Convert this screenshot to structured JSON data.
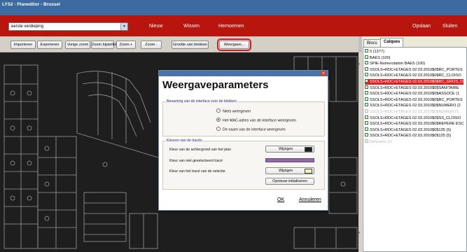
{
  "window": {
    "title": "LYS2 - Planeditor - Brussel"
  },
  "menubar": {
    "floor_selector": "eerste verdieping",
    "items": [
      "Nieuw",
      "Wissen",
      "Hernoemen",
      "Opslaan",
      "Sluiten"
    ]
  },
  "toolbar": {
    "buttons": [
      "Importeren",
      "Exporteren",
      "Vorige zoom",
      "Zoom bijstellen",
      "Zoom +",
      "Zoom -",
      "Grootte van blokken",
      "Weergave..."
    ]
  },
  "panel": {
    "tabs": [
      "Blocs",
      "Calques"
    ],
    "layers": [
      {
        "label": "0  (1377)",
        "state": "normal"
      },
      {
        "label": "BAES  (100)",
        "state": "normal"
      },
      {
        "label": "SPIE-Numerotation BAES  (100)",
        "state": "normal"
      },
      {
        "label": "SSOLS+RDC+ETAGES 02.03.2010$0$RC_PORTES",
        "state": "normal"
      },
      {
        "label": "SSOLS+RDC+ETAGES 02.03.2010$0$RC_CLOISO",
        "state": "normal"
      },
      {
        "label": "SSOLS+RDC+ETAGES 02.03.2010$0$RC_GROS_O",
        "state": "highlight"
      },
      {
        "label": "SSOLS+RDC+ETAGES 02.03.2010$0$SANITAIRE",
        "state": "normal"
      },
      {
        "label": "SSOLS+RDC+ETAGES 02.03.2010$0$ASSOCE  (1",
        "state": "normal"
      },
      {
        "label": "SSOLS+RDC+ETAGES 02.03.2010$0$RC_PORTES",
        "state": "normal"
      },
      {
        "label": "SSOLS+RDC+ETAGES 02.03.2010$0$NUMERO  (2",
        "state": "normal"
      },
      {
        "label": "SSOLS+RDC+ETAGES 02.03.2010$0$NUMEROS",
        "state": "dim"
      },
      {
        "label": "SSOLS+RDC+ETAGES 02.03.2010$0$SS_CLOISO",
        "state": "normal"
      },
      {
        "label": "SSOLS+RDC+ETAGES 02.03.2010$0$REPERE ESC",
        "state": "normal"
      },
      {
        "label": "SSOLS+RDC+ETAGES 02.03.2010$0$135  (5)",
        "state": "normal"
      },
      {
        "label": "SSOLS+RDC+ETAGES 02.03.2010$0$125  (5)",
        "state": "normal"
      },
      {
        "label": "Defpoints  (0)",
        "state": "dim"
      }
    ]
  },
  "dialog": {
    "title": "Weergaveparameters",
    "close_glyph": "✕",
    "group_naming": {
      "label": "Benaming van de interface voor de blokken",
      "options": [
        "Niets weergeven",
        "Het MAC-adres van de interface weergeven",
        "De naam van de interface weergeven"
      ],
      "selected_index": 1
    },
    "group_colors": {
      "label": "Kleuren van de tracés",
      "rows": [
        {
          "label": "Kleur van de achtergrond van het plan",
          "button": "Wijzigen",
          "color": "#1e1e1e"
        },
        {
          "label": "Kleur van niet geselecteerd tracé",
          "button": "",
          "color": "#8e6aa0"
        },
        {
          "label": "Kleur van het tracé van de selectie",
          "button": "Wijzigen",
          "color": "#f2f2b8"
        }
      ],
      "reset_button": "Opnieuw initialiseren"
    },
    "ok": "OK",
    "cancel": "Annuleren"
  },
  "colors": {
    "titlebar": "#3d6a9f",
    "menubar": "#b7150d",
    "canvas": "#1e1e1e",
    "highlight": "#e02020"
  }
}
